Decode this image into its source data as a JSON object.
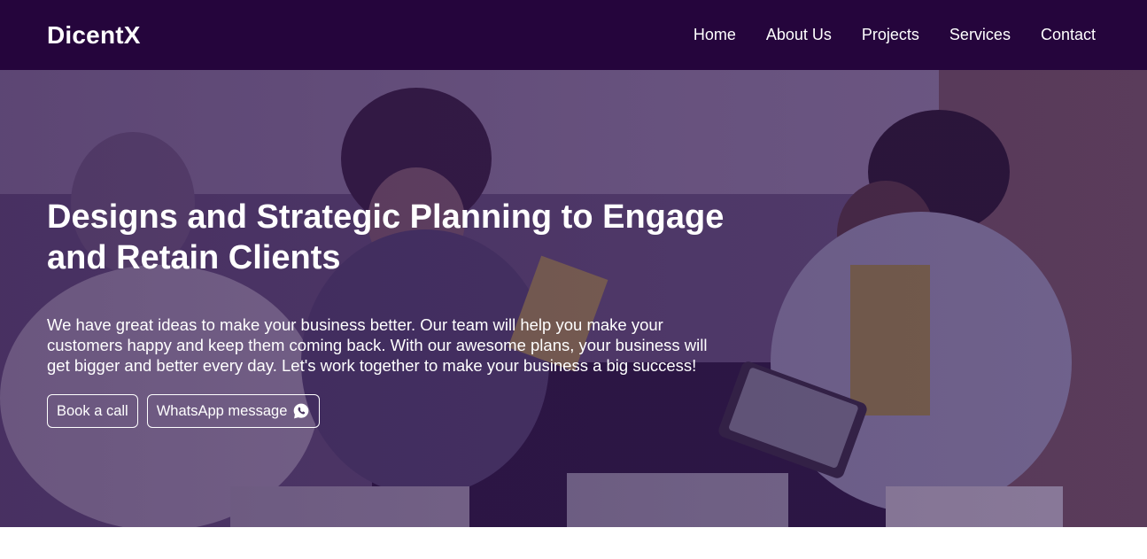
{
  "navbar": {
    "brand": "DicentX",
    "links": [
      {
        "label": "Home"
      },
      {
        "label": "About Us"
      },
      {
        "label": "Projects"
      },
      {
        "label": "Services"
      },
      {
        "label": "Contact"
      }
    ]
  },
  "hero": {
    "title": "Designs and Strategic Planning to Engage and Retain Clients",
    "text": "We have great ideas to make your business better. Our team will help you make your customers happy and keep them coming back. With our awesome plans, your business will get bigger and better every day. Let's work together to make your business a big success!",
    "buttons": {
      "book_call": "Book a call",
      "whatsapp": "WhatsApp message",
      "whatsapp_icon": "whatsapp-icon"
    }
  },
  "colors": {
    "navbar_bg": "#25053c",
    "overlay": "#2a0e44",
    "text": "#ffffff"
  }
}
